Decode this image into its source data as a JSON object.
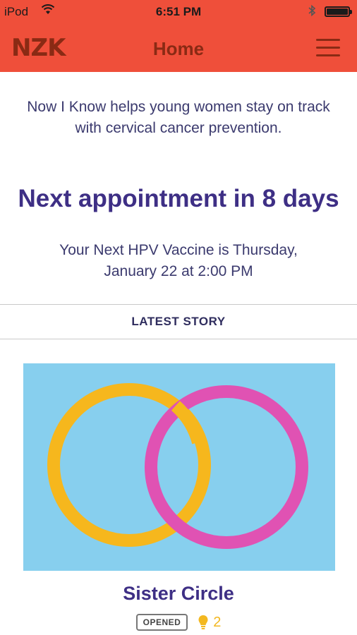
{
  "status_bar": {
    "carrier": "iPod",
    "time": "6:51 PM"
  },
  "header": {
    "logo": "NZK",
    "title": "Home",
    "icons": [
      "wifi-icon",
      "bluetooth-icon",
      "battery-icon",
      "menu-icon"
    ]
  },
  "intro_text": "Now I Know helps young women stay on track with cervical cancer prevention.",
  "appointment": {
    "headline": "Next appointment in 8 days",
    "detail_line1": "Your Next HPV Vaccine is Thursday,",
    "detail_line2": "January 22 at 2:00 PM"
  },
  "latest_story": {
    "section_label": "LATEST STORY",
    "title": "Sister Circle",
    "status_badge": "OPENED",
    "like_count": "2",
    "colors": {
      "background": "#87cfee",
      "ring_left": "#f6b71d",
      "ring_right": "#e052b3"
    }
  },
  "colors": {
    "header_bg": "#ef4f3a",
    "header_fg": "#8a2a14",
    "headline": "#3e2f85"
  }
}
